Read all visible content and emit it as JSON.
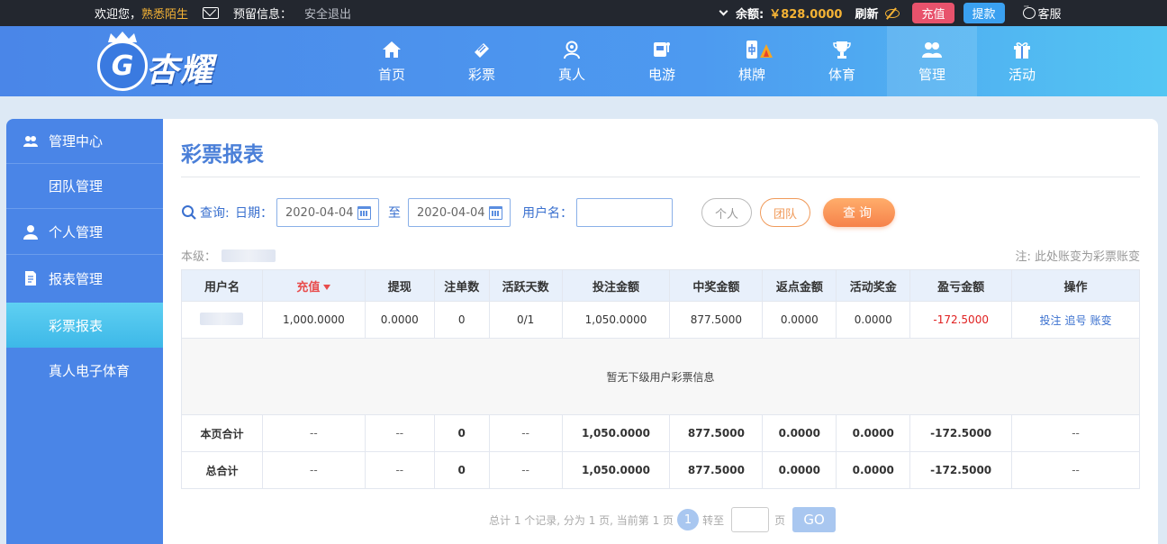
{
  "topbar": {
    "welcome": "欢迎您，",
    "username": "熟悉陌生",
    "reserved_info": "预留信息：",
    "logout": "安全退出",
    "balance_label": "余额:",
    "balance_value": "￥828.0000",
    "refresh": "刷新",
    "recharge": "充值",
    "withdraw": "提款",
    "service": "客服"
  },
  "logo": {
    "text": "杏耀"
  },
  "nav": {
    "items": [
      {
        "label": "首页",
        "icon": "home-icon"
      },
      {
        "label": "彩票",
        "icon": "lottery-ticket-icon"
      },
      {
        "label": "真人",
        "icon": "live-dealer-icon"
      },
      {
        "label": "电游",
        "icon": "slot-machine-icon"
      },
      {
        "label": "棋牌",
        "icon": "mahjong-tile-icon"
      },
      {
        "label": "体育",
        "icon": "trophy-icon"
      },
      {
        "label": "管理",
        "icon": "users-icon"
      },
      {
        "label": "活动",
        "icon": "gift-icon"
      }
    ],
    "active": "管理"
  },
  "sidebar": {
    "items": [
      {
        "label": "管理中心",
        "icon": "users-icon"
      },
      {
        "label": "团队管理"
      },
      {
        "label": "个人管理",
        "icon": "user-icon"
      },
      {
        "label": "报表管理",
        "icon": "report-icon"
      },
      {
        "label": "彩票报表",
        "active": true
      },
      {
        "label": "真人电子体育"
      }
    ]
  },
  "main": {
    "title": "彩票报表",
    "filter": {
      "query_label": "查询:",
      "date_label": "日期：",
      "date_from": "2020-04-04",
      "to_label": "至",
      "date_to": "2020-04-04",
      "username_label": "用户名：",
      "username_value": "",
      "btn_person": "个人",
      "btn_team": "团队",
      "btn_query": "查询"
    },
    "level_label": "本级：",
    "note": "注: 此处账变为彩票账变",
    "table": {
      "headers": [
        "用户名",
        "充值",
        "提现",
        "注单数",
        "活跃天数",
        "投注金额",
        "中奖金额",
        "返点金额",
        "活动奖金",
        "盈亏金额",
        "操作"
      ],
      "row": [
        "",
        "1,000.0000",
        "0.0000",
        "0",
        "0/1",
        "1,050.0000",
        "877.5000",
        "0.0000",
        "0.0000",
        "-172.5000"
      ],
      "ops": [
        "投注",
        "追号",
        "账变"
      ],
      "empty_text": "暂无下级用户彩票信息",
      "page_total": [
        "本页合计",
        "--",
        "--",
        "0",
        "--",
        "1,050.0000",
        "877.5000",
        "0.0000",
        "0.0000",
        "-172.5000",
        "--"
      ],
      "grand_total": [
        "总合计",
        "--",
        "--",
        "0",
        "--",
        "1,050.0000",
        "877.5000",
        "0.0000",
        "0.0000",
        "-172.5000",
        "--"
      ]
    },
    "pager": {
      "summary": "总计 1 个记录, 分为 1 页, 当前第 1 页",
      "current": "1",
      "goto_label": "转至",
      "page_unit": "页",
      "go": "GO"
    }
  },
  "colors": {
    "header_start": "#4a86e8",
    "header_end": "#53c6f3",
    "sidebar": "#4a85e7",
    "accent_orange": "#f6824a",
    "negative": "#e02020",
    "balance": "#f5b335"
  }
}
